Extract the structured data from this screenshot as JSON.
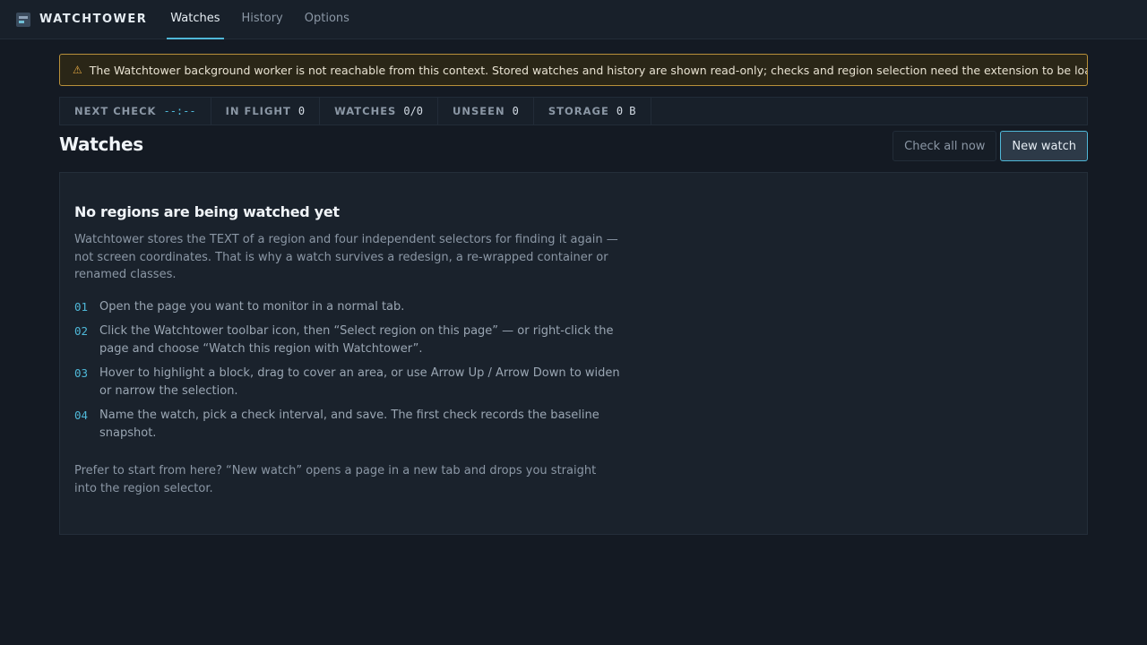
{
  "app": {
    "name": "WATCHTOWER"
  },
  "nav": {
    "tabs": [
      {
        "label": "Watches",
        "active": true
      },
      {
        "label": "History",
        "active": false
      },
      {
        "label": "Options",
        "active": false
      }
    ]
  },
  "warning": {
    "icon": "warning-triangle-icon",
    "text": "The Watchtower background worker is not reachable from this context. Stored watches and history are shown read-only; checks and region selection need the extension to be loaded."
  },
  "stats": [
    {
      "label": "NEXT CHECK",
      "value": "--:--"
    },
    {
      "label": "IN FLIGHT",
      "value": "0"
    },
    {
      "label": "WATCHES",
      "value": "0/0"
    },
    {
      "label": "UNSEEN",
      "value": "0"
    },
    {
      "label": "STORAGE",
      "value": "0 B"
    }
  ],
  "page": {
    "title": "Watches",
    "check_all_label": "Check all now",
    "new_watch_label": "New watch"
  },
  "empty_state": {
    "title": "No regions are being watched yet",
    "intro": "Watchtower stores the TEXT of a region and four independent selectors for finding it again — not screen coordinates. That is why a watch survives a redesign, a re-wrapped container or renamed classes.",
    "steps": [
      {
        "num": "01",
        "text": "Open the page you want to monitor in a normal tab."
      },
      {
        "num": "02",
        "text": "Click the Watchtower toolbar icon, then “Select region on this page” — or right-click the page and choose “Watch this region with Watchtower”."
      },
      {
        "num": "03",
        "text": "Hover to highlight a block, drag to cover an area, or use Arrow Up / Arrow Down to widen or narrow the selection."
      },
      {
        "num": "04",
        "text": "Name the watch, pick a check interval, and save. The first check records the baseline snapshot."
      }
    ],
    "footer": "Prefer to start from here? “New watch” opens a page in a new tab and drops you straight into the region selector."
  },
  "colors": {
    "accent": "#4fb8d8",
    "warning_border": "#b8903a",
    "background": "#141a23"
  }
}
